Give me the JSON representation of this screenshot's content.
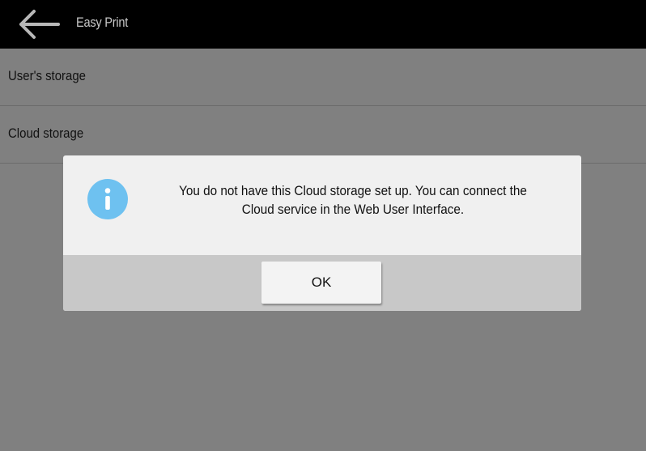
{
  "header": {
    "back_icon": "arrow-left-icon",
    "title": "Easy Print"
  },
  "list": {
    "items": [
      {
        "label": "User's storage"
      },
      {
        "label": "Cloud storage"
      }
    ]
  },
  "dialog": {
    "icon": "info-icon",
    "message": "You do not have this Cloud storage set up. You can connect the Cloud service in the Web User Interface.",
    "ok_label": "OK"
  },
  "colors": {
    "topbar": "#000000",
    "background_dimmed": "#808080",
    "dialog_body": "#f0f0f0",
    "dialog_footer": "#c8c8c8",
    "info_icon": "#6ec1f0"
  }
}
